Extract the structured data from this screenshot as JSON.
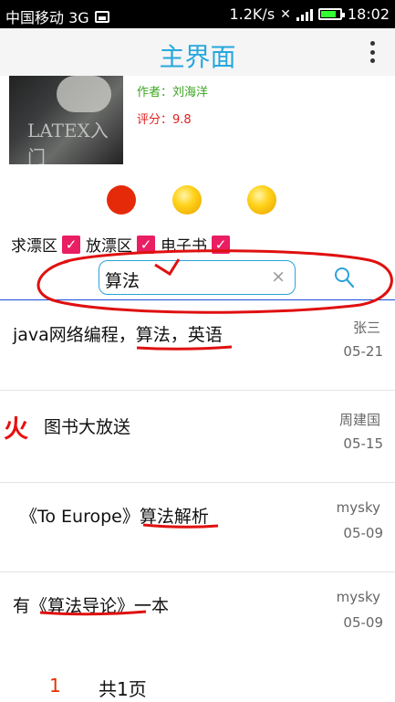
{
  "status_bar": {
    "carrier": "中国移动 3G",
    "speed": "1.2K/s",
    "time": "18:02",
    "battery_fraction": 0.8
  },
  "app_bar": {
    "title": "主界面",
    "overflow_icon": "more-vertical-icon"
  },
  "book": {
    "cover_text": "LATEX入门",
    "author": "作者：刘海洋",
    "rating": "评分：9.8"
  },
  "indicator_dots": [
    "red",
    "yellow",
    "yellow"
  ],
  "filters": [
    {
      "label": "求漂区",
      "checked": true
    },
    {
      "label": "放漂区",
      "checked": true
    },
    {
      "label": "电子书",
      "checked": true
    }
  ],
  "search": {
    "value": "算法",
    "clear_icon": "×",
    "search_icon": "search-icon"
  },
  "posts": [
    {
      "title": "java网络编程，算法，英语",
      "user": "张三",
      "date": "05-21",
      "hot": false
    },
    {
      "title": "图书大放送",
      "user": "周建国",
      "date": "05-15",
      "hot": true,
      "hot_label": "火"
    },
    {
      "title": "《To Europe》算法解析",
      "user": "mysky",
      "date": "05-09",
      "hot": false
    },
    {
      "title": "有《算法导论》一本",
      "user": "mysky",
      "date": "05-09",
      "hot": false
    }
  ],
  "pagination": {
    "current": "1",
    "total": "共1页"
  },
  "colors": {
    "accent": "#26a8de",
    "checkbox": "#e91e63",
    "hot": "#e81010",
    "annotation": "#e01010"
  }
}
